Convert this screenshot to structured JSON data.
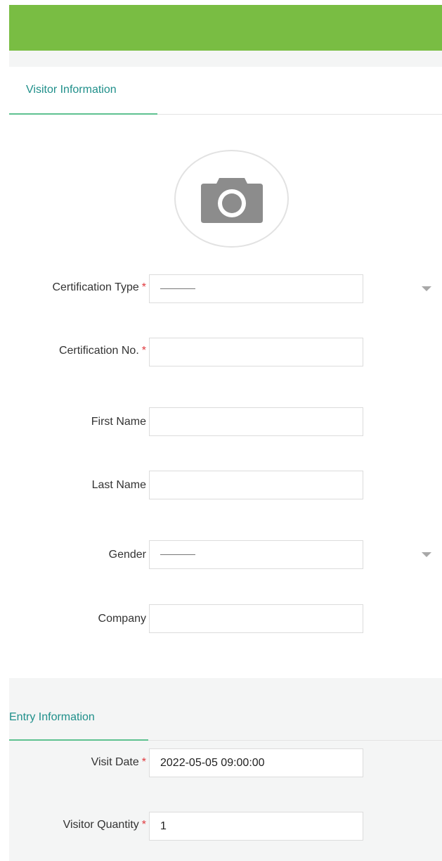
{
  "header": {
    "bar_color": "#79bd43"
  },
  "visitor_section": {
    "tab_label": "Visitor Information",
    "photo_icon": "camera-icon"
  },
  "fields": {
    "certification_type": {
      "label": "Certification Type",
      "required_mark": "*",
      "value": "--------",
      "icon": "chevron-down-icon"
    },
    "certification_no": {
      "label": "Certification No.",
      "required_mark": "*",
      "value": ""
    },
    "first_name": {
      "label": "First Name",
      "value": ""
    },
    "last_name": {
      "label": "Last Name",
      "value": ""
    },
    "gender": {
      "label": "Gender",
      "value": "--------",
      "icon": "chevron-down-icon"
    },
    "company": {
      "label": "Company",
      "value": ""
    }
  },
  "entry_section": {
    "tab_label": "Entry Information",
    "visit_date": {
      "label": "Visit Date",
      "required_mark": "*",
      "value": "2022-05-05 09:00:00"
    },
    "visitor_quantity": {
      "label": "Visitor Quantity",
      "required_mark": "*",
      "value": "1"
    }
  },
  "colors": {
    "accent_green": "#79bd43",
    "tab_text": "#1f8f8a",
    "tab_underline": "#5ec290",
    "required": "#e0393e"
  }
}
